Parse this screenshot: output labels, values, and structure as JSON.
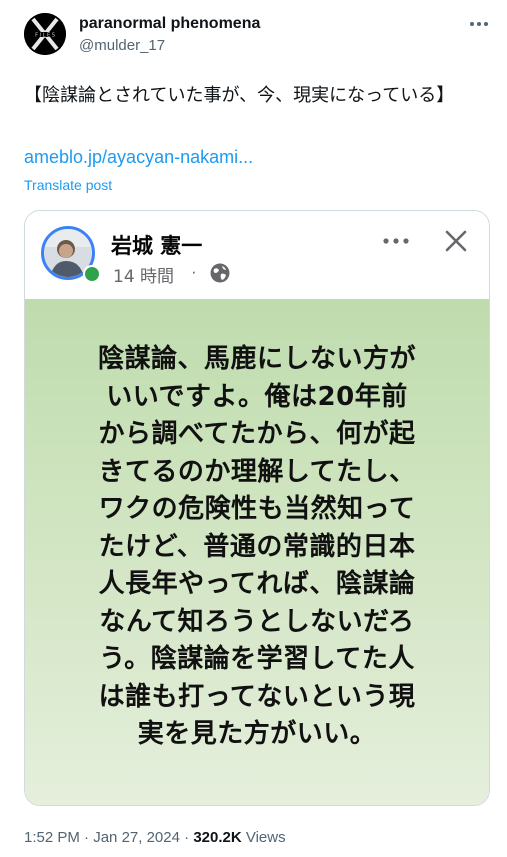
{
  "tweet": {
    "author_name": "paranormal phenomena",
    "author_handle": "@mulder_17",
    "text": "【陰謀論とされていた事が、今、現実になっている】",
    "link": "ameblo.jp/ayacyan-nakami...",
    "translate_label": "Translate post",
    "time": "1:52 PM",
    "date": "Jan 27, 2024",
    "views_count": "320.2K",
    "views_label": "Views",
    "sep": "·"
  },
  "embedded_post": {
    "author_name": "岩城 憲一",
    "time": "14 時間",
    "sep": "·",
    "body_lines": [
      "陰謀論、馬鹿にしない方が",
      "いいですよ。俺は20年前",
      "から調べてたから、何が起",
      "きてるのか理解してたし、",
      "ワクの危険性も当然知って",
      "たけど、普通の常識的日本",
      "人長年やってれば、陰謀論",
      "なんて知ろうとしないだろ",
      "う。陰謀論を学習してた人",
      "は誰も打ってないという現",
      "実を見た方がいい。"
    ]
  },
  "icons": {
    "tweet_more": "more-horizontal-icon",
    "post_more": "more-horizontal-icon",
    "close": "close-icon",
    "globe": "globe-icon"
  },
  "colors": {
    "link": "#1d9bf0",
    "secondary_text": "#536471",
    "card_bg_top": "#bfdcae",
    "card_bg_bottom": "#e5efdc",
    "online_dot": "#31a24c"
  }
}
